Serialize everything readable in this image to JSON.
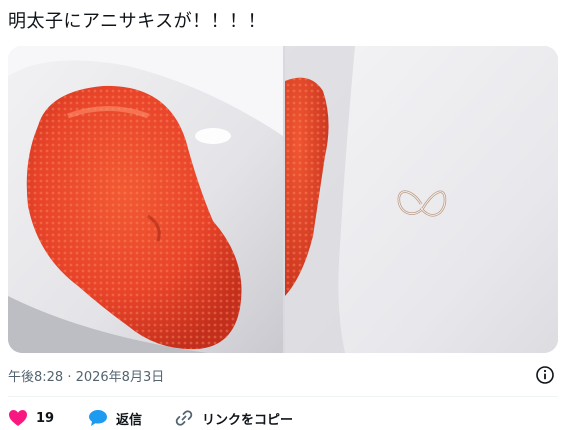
{
  "post": {
    "text": "明太子にアニサキスが！！！！",
    "timestamp": "午後8:28 · 2026年8月3日"
  },
  "media": {
    "images": [
      {
        "icon": "photo-mentaiko"
      },
      {
        "icon": "photo-anisakis"
      }
    ]
  },
  "actions": {
    "like_count": "19",
    "reply_label": "返信",
    "copy_link_label": "リンクをコピー"
  },
  "colors": {
    "like": "#f91880",
    "reply": "#1d9bf0",
    "muted": "#536471"
  },
  "icons": {
    "info": "info-circle-icon",
    "like": "heart-icon",
    "reply": "speech-bubble-icon",
    "link": "link-icon"
  }
}
